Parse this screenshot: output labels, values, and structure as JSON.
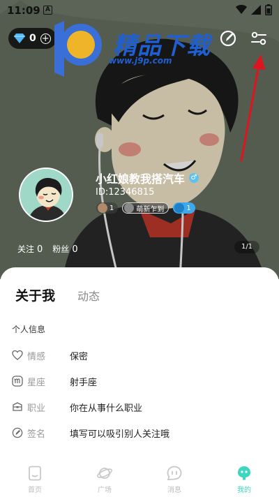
{
  "status_bar": {
    "time": "11:09",
    "notif_letter": "A"
  },
  "wallet": {
    "diamonds": "0"
  },
  "watermark": {
    "title": "精品下载",
    "url": "www.j9p.com"
  },
  "profile": {
    "nickname": "小红娘教我搭汽车",
    "gender_symbol": "♂",
    "id_text": "ID:12346815",
    "badges": [
      {
        "label": "1",
        "color": "#b08a6a"
      },
      {
        "label": "萌新乍到",
        "color": "#8a8a8a"
      },
      {
        "label": "1",
        "color": "#3fa8ea"
      }
    ],
    "following_label": "关注",
    "following_count": "0",
    "fans_label": "粉丝",
    "fans_count": "0",
    "page_indicator": "1/1"
  },
  "tabs": {
    "about": "关于我",
    "dynamic": "动态"
  },
  "info": {
    "section_title": "个人信息",
    "rows": [
      {
        "icon": "heart-icon",
        "label": "情感",
        "value": "保密"
      },
      {
        "icon": "zodiac-icon",
        "label": "星座",
        "value": "射手座"
      },
      {
        "icon": "briefcase-icon",
        "label": "职业",
        "value": "你在从事什么职业"
      },
      {
        "icon": "pen-icon",
        "label": "签名",
        "value": "填写可以吸引别人关注哦"
      }
    ]
  },
  "nav": [
    {
      "label": "首页",
      "icon": "home-icon",
      "active": false
    },
    {
      "label": "广场",
      "icon": "planet-icon",
      "active": false
    },
    {
      "label": "消息",
      "icon": "chat-icon",
      "active": false
    },
    {
      "label": "我的",
      "icon": "profile-face-icon",
      "active": true
    }
  ],
  "colors": {
    "accent": "#3ed6c2",
    "gender_badge": "#5ec2ec",
    "arrow": "#e0141e",
    "watermark": "#1f5fd0"
  }
}
